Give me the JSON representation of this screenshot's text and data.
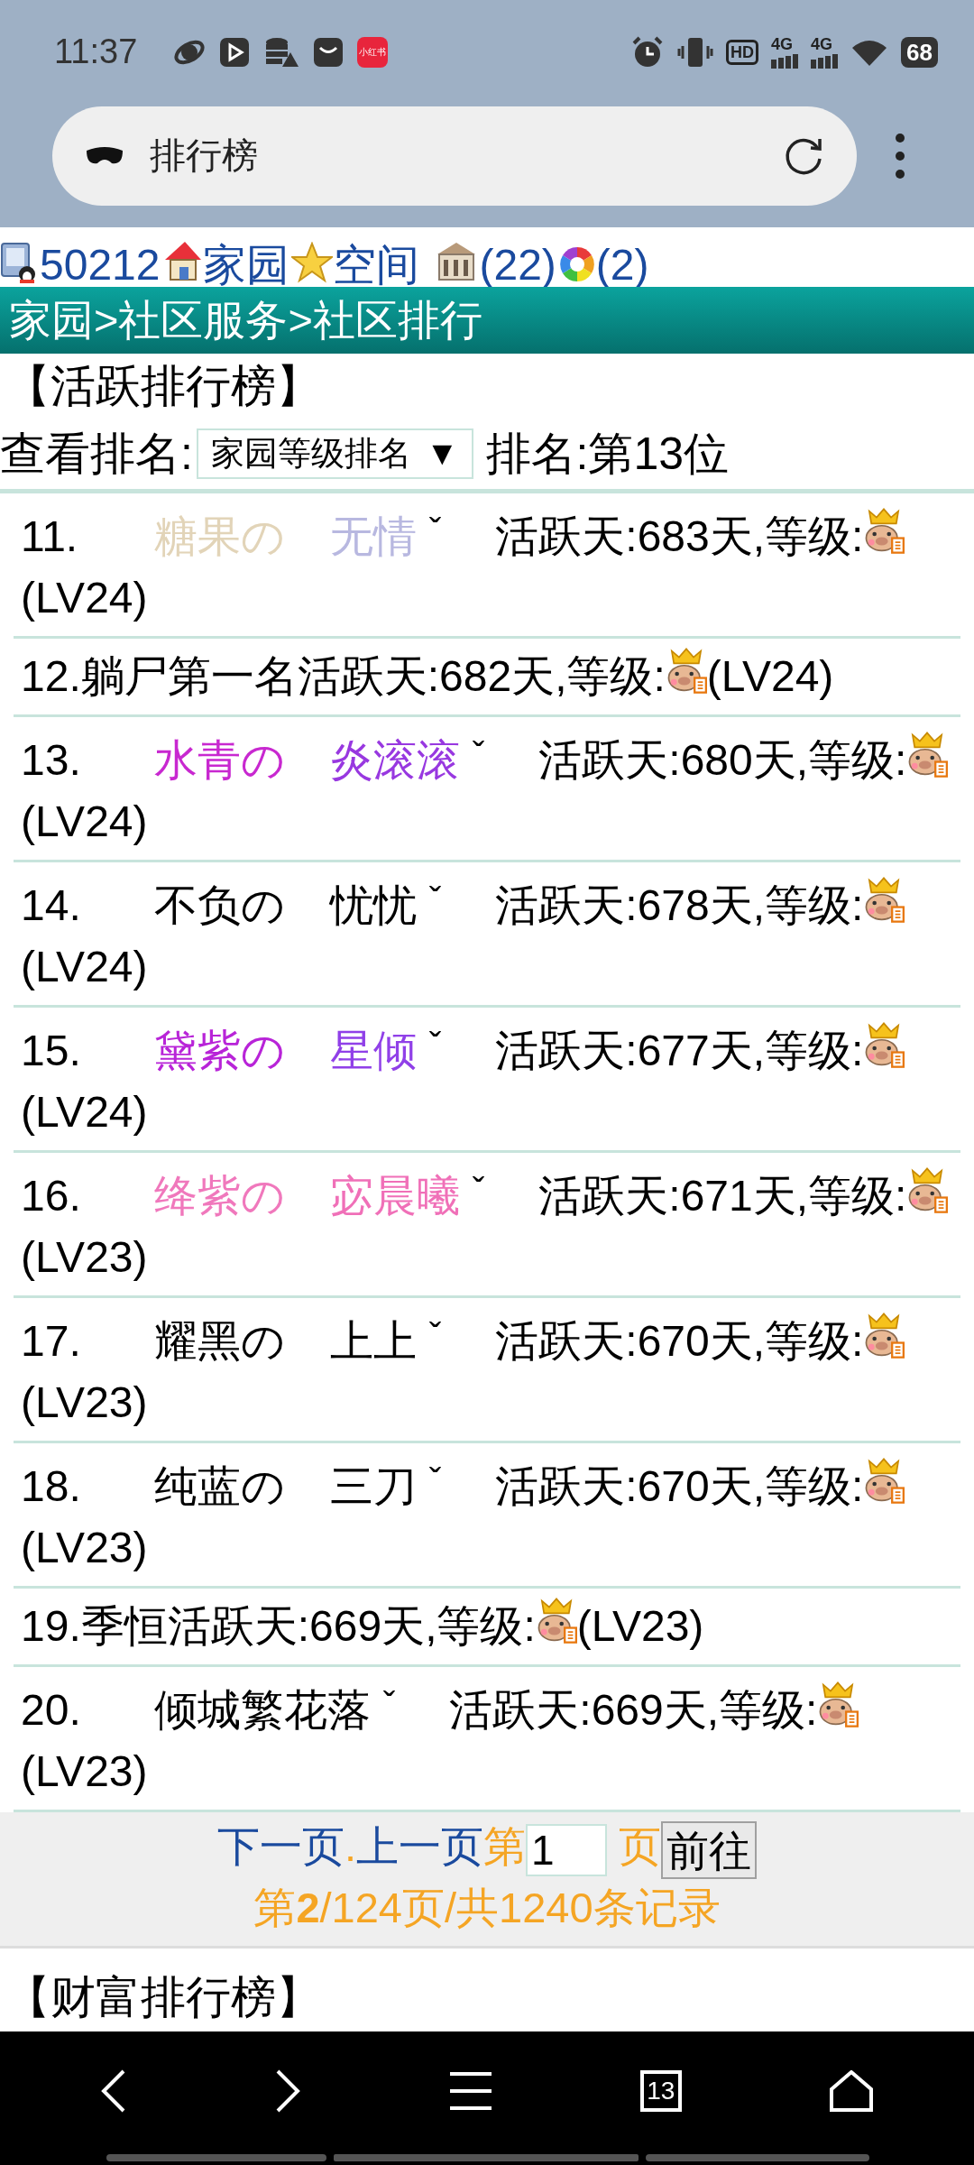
{
  "status_bar": {
    "time": "11:37",
    "app_label": "小红书",
    "hd": "HD",
    "network": [
      "4G",
      "4G"
    ],
    "battery": "68"
  },
  "address_bar": {
    "title": "排行榜"
  },
  "user_bar": [
    {
      "kind": "qq",
      "text": "50212"
    },
    {
      "kind": "home",
      "text": "家园"
    },
    {
      "kind": "star",
      "text": "空间"
    },
    {
      "kind": "building",
      "text": "(22)"
    },
    {
      "kind": "aperture",
      "text": "(2)"
    }
  ],
  "breadcrumb": "家园>社区服务>社区排行",
  "section_title": "【活跃排行榜】",
  "filter": {
    "label": "查看排名:",
    "select_value": "家园等级排名",
    "caret": "▼",
    "rank": "排名:第13位"
  },
  "rows": [
    {
      "kind": "styled",
      "rank": "11.",
      "name_parts": [
        {
          "text": "糖果の",
          "color": "#e2d4b8"
        },
        {
          "text": "无情",
          "color": "#b8b8e0"
        }
      ],
      "mark": "ˇ",
      "activity": "活跃天:683天,等级:",
      "level": "(LV24)"
    },
    {
      "kind": "plain",
      "rank": "12.",
      "name_parts": [
        {
          "text": "躺尸第一名",
          "color": "#000000"
        }
      ],
      "activity": "活跃天:682天,等级:",
      "level": "(LV24)"
    },
    {
      "kind": "styled",
      "rank": "13.",
      "name_parts": [
        {
          "text": "水青の",
          "color": "#c828d0"
        },
        {
          "text": "炎滚滚",
          "color": "#9838e0"
        }
      ],
      "mark": "ˇ",
      "activity": "活跃天:680天,等级:",
      "level": "(LV24)"
    },
    {
      "kind": "styled",
      "rank": "14.",
      "name_parts": [
        {
          "text": "不负の",
          "color": "#000000"
        },
        {
          "text": "忧忧",
          "color": "#000000"
        }
      ],
      "mark": "ˇ",
      "activity": "活跃天:678天,等级:",
      "level": "(LV24)"
    },
    {
      "kind": "styled",
      "rank": "15.",
      "name_parts": [
        {
          "text": "黛紫の",
          "color": "#b824d8"
        },
        {
          "text": "星倾",
          "color": "#9040e8"
        }
      ],
      "mark": "ˇ",
      "activity": "活跃天:677天,等级:",
      "level": "(LV24)"
    },
    {
      "kind": "styled",
      "rank": "16.",
      "name_parts": [
        {
          "text": "绛紫の",
          "color": "#f078bc"
        },
        {
          "text": "宓晨曦",
          "color": "#f070b8"
        }
      ],
      "mark": "ˇ",
      "activity": "活跃天:671天,等级:",
      "level": "(LV23)"
    },
    {
      "kind": "styled",
      "rank": "17.",
      "name_parts": [
        {
          "text": "耀黑の",
          "color": "#000000"
        },
        {
          "text": "上上",
          "color": "#000000"
        }
      ],
      "mark": "ˇ",
      "activity": "活跃天:670天,等级:",
      "level": "(LV23)"
    },
    {
      "kind": "styled",
      "rank": "18.",
      "name_parts": [
        {
          "text": "纯蓝の",
          "color": "#000000"
        },
        {
          "text": "三刀",
          "color": "#000000"
        }
      ],
      "mark": "ˇ",
      "activity": "活跃天:670天,等级:",
      "level": "(LV23)"
    },
    {
      "kind": "plain",
      "rank": "19.",
      "name_parts": [
        {
          "text": "季恒",
          "color": "#000000"
        }
      ],
      "activity": "活跃天:669天,等级:",
      "level": "(LV23)"
    },
    {
      "kind": "styled",
      "rank": "20.",
      "name_parts": [
        {
          "text": "倾城繁花落",
          "color": "#000000"
        }
      ],
      "mark": "ˇ",
      "activity": "活跃天:669天,等级:",
      "level": "(LV23)"
    }
  ],
  "pager": {
    "next": "下一页",
    "separator": ".",
    "prev": "上一页",
    "page_prefix": "第",
    "page_value": "1",
    "page_suffix": "页",
    "go": "前往",
    "summary": "第**2**/124页/共1240条记录"
  },
  "next_section": "【财富排行榜】",
  "nav_bar": {
    "tab_count": "13"
  }
}
